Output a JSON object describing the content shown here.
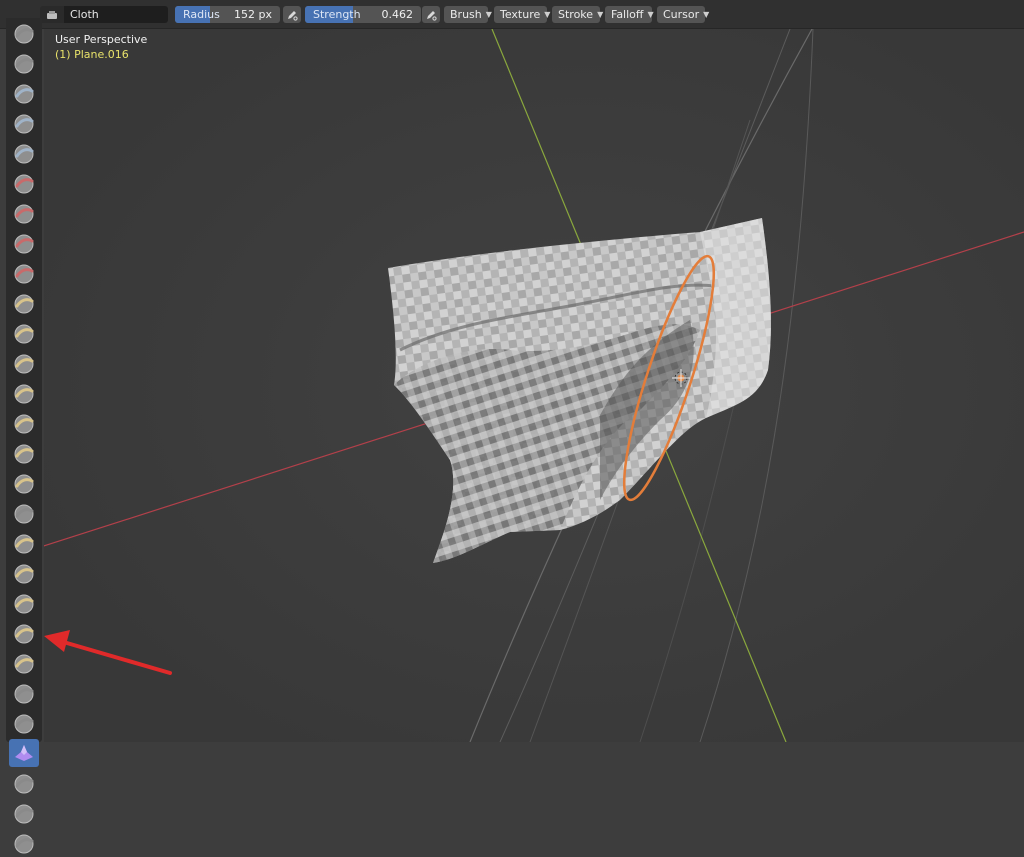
{
  "header": {
    "brush_name": "Cloth",
    "radius": {
      "label": "Radius",
      "value": "152 px",
      "fill_fraction": 0.33
    },
    "strength": {
      "label": "Strength",
      "value": "0.462",
      "fill_fraction": 0.41
    },
    "menus": [
      "Brush",
      "Texture",
      "Stroke",
      "Falloff",
      "Cursor"
    ]
  },
  "viewport": {
    "title": "User Perspective",
    "active_object": "(1) Plane.016"
  },
  "toolbar": {
    "tools": [
      "draw",
      "draw-sharp",
      "clay",
      "clay-strips",
      "clay-thumb",
      "layer",
      "inflate",
      "blob",
      "crease",
      "smooth",
      "flatten",
      "fill",
      "scrape",
      "multiplane-scrape",
      "pinch",
      "grab",
      "elastic-deform",
      "snake-hook",
      "thumb",
      "pose",
      "nudge",
      "rotate",
      "slide-relax",
      "boundary",
      "cloth",
      "simplify",
      "mask",
      "draw-face-sets"
    ],
    "active_tool": "cloth"
  },
  "colors": {
    "accent": "#4772b3",
    "x_axis": "#b3404a",
    "y_axis": "#8aa83d",
    "brush_ring": "#e37d3a",
    "object_name": "#e8e26a",
    "annotation_arrow": "#e02a2a"
  }
}
